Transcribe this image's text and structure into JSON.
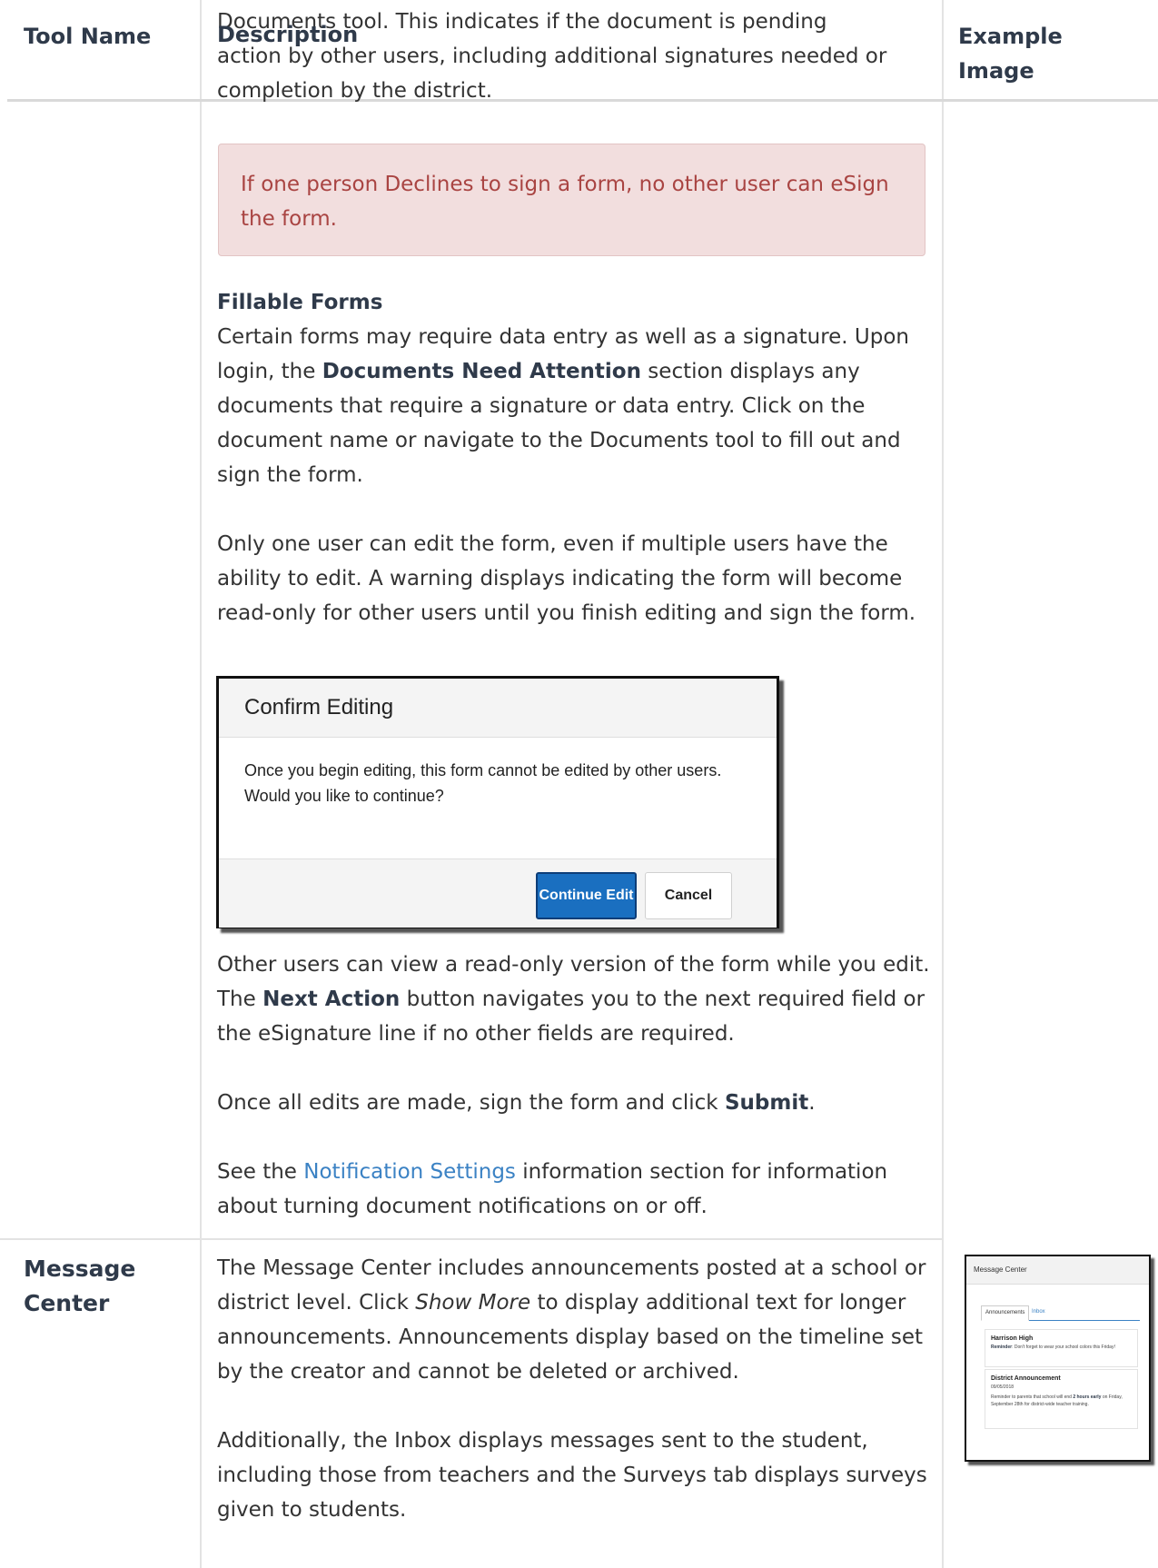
{
  "table": {
    "headers": {
      "tool_name": "Tool Name",
      "description": "Description",
      "example_line1": "Example",
      "example_line2": "Image"
    },
    "overflow_text": {
      "line1": "Documents tool. This indicates if the document is pending",
      "line2": "action by other users, including additional signatures needed or",
      "line3": "completion by the district."
    }
  },
  "documents_row": {
    "alert": "If one person Declines to sign a form, no other user can eSign the form.",
    "fillable_heading": "Fillable Forms",
    "para1": {
      "a": "Certain forms may require data entry as well as a signature. Upon login, the ",
      "b": "Documents Need Attention",
      "c": " section displays any documents that require a signature or data entry. Click on the document name or navigate to the Documents tool to fill out and sign the form."
    },
    "para2": "Only one user can edit the form, even if multiple users have the ability to edit. A warning displays indicating the form will become read-only for other users until you finish editing and sign the form.",
    "dialog": {
      "title": "Confirm Editing",
      "body": "Once you begin editing, this form cannot be edited by other users. Would you like to continue?",
      "continue_label": "Continue Edit",
      "cancel_label": "Cancel"
    },
    "para3": {
      "a": "Other users can view a read-only version of the form while you edit. The ",
      "b": "Next Action",
      "c": " button navigates you to the next required field or the eSignature line if no other fields are required."
    },
    "para4": {
      "a": "Once all edits are made, sign the form and click ",
      "b": "Submit",
      "c": "."
    },
    "para5": {
      "a": "See the ",
      "link": "Notification Settings",
      "c": " information section for information about turning document notifications on or off."
    }
  },
  "message_center_row": {
    "tool_name": "Message Center",
    "para1": {
      "a": "The Message Center includes announcements posted at a school or district level. Click ",
      "em": "Show More",
      "c": " to display additional text for longer announcements. Announcements display based on the timeline set by the creator and cannot be deleted or archived."
    },
    "para2": "Additionally, the Inbox displays messages sent to the student, including those from teachers and the Surveys tab displays surveys given to students.",
    "thumbnail": {
      "title": "Message Center",
      "tab1": "Announcements",
      "tab2": "Inbox",
      "card1_title": "Harrison High",
      "card1_label": "Reminder",
      "card1_text": ": Don't forget to wear your school colors this Friday!",
      "card2_title": "District Announcement",
      "card2_date": "09/05/2018",
      "card2_text_a": "Reminder to parents that school will end ",
      "card2_text_b": "2 hours early",
      "card2_text_c": " on Friday, September 28th for district-wide teacher training."
    }
  },
  "colors": {
    "alert_bg": "#f2dede",
    "alert_text": "#a94442",
    "link": "#3b82c4",
    "primary_button": "#1a6fc0"
  }
}
